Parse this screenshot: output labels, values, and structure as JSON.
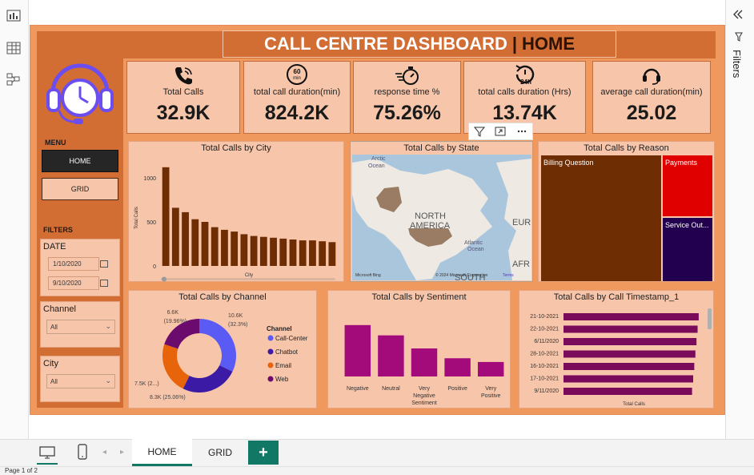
{
  "title": {
    "main": "CALL CENTRE DASHBOARD",
    "separator": "|",
    "page": "HOME"
  },
  "kpis": [
    {
      "icon": "phone-icon",
      "label": "Total Calls",
      "value": "32.9K"
    },
    {
      "icon": "sixty-min-icon",
      "icon_text": "60 min",
      "label": "total call duration(min)",
      "value": "824.2K"
    },
    {
      "icon": "stopwatch-icon",
      "label": "response time %",
      "value": "75.26%"
    },
    {
      "icon": "clock-24h-icon",
      "icon_text": "24h",
      "label": "total calls duration (Hrs)",
      "value": "13.74K"
    },
    {
      "icon": "headset-icon",
      "label": "average call duration(min)",
      "value": "25.02"
    }
  ],
  "sidebar": {
    "menu_label": "MENU",
    "menu_items": [
      {
        "label": "HOME",
        "active": true
      },
      {
        "label": "GRID",
        "active": false
      }
    ],
    "filters_label": "FILTERS",
    "date_label": "DATE",
    "date_from": "1/10/2020",
    "date_to": "9/10/2020",
    "channel_label": "Channel",
    "channel_value": "All",
    "city_label": "City",
    "city_value": "All"
  },
  "visual_header_icons": [
    "filter-icon",
    "focus-mode-icon",
    "more-options-icon"
  ],
  "map": {
    "labels": {
      "arctic": "Arctic Ocean",
      "north_america": "NORTH AMERICA",
      "atlantic": "Atlantic Ocean",
      "europe": "EUR",
      "africa": "AFR",
      "south": "SOUTH",
      "logo": "Microsoft Bing",
      "copyright": "© 2024 Microsoft Corporation",
      "terms": "Terms"
    }
  },
  "treemap": {
    "items": [
      {
        "label": "Billing Question",
        "color": "#6e2d02"
      },
      {
        "label": "Payments",
        "color": "#e00000"
      },
      {
        "label": "Service Out...",
        "color": "#22004f"
      }
    ]
  },
  "tabs": {
    "home": "HOME",
    "grid": "GRID",
    "add": "+"
  },
  "status": "Page 1 of 2",
  "filters_pane": "Filters",
  "colors": {
    "sidebar": "#d26d34",
    "background": "#f0995f",
    "card": "#f7c5aa",
    "bar_brown": "#6e2d02",
    "bar_magenta": "#a30b7a",
    "bar_plum": "#7a0a5a"
  },
  "chart_data": [
    {
      "type": "bar",
      "title": "Total Calls by City",
      "xlabel": "City",
      "ylabel": "Total Calls",
      "ylim": [
        0,
        1000
      ],
      "yticks": [
        "0",
        "500",
        "1000"
      ],
      "values": [
        1120,
        660,
        610,
        530,
        500,
        440,
        410,
        390,
        360,
        340,
        330,
        320,
        310,
        300,
        290,
        290,
        280,
        270
      ]
    },
    {
      "type": "pie",
      "title": "Total Calls by Channel",
      "legend_title": "Channel",
      "slices": [
        {
          "name": "Call-Center",
          "value": 10.6,
          "label_value": "10.6K",
          "label_pct": "(32.3%)",
          "color": "#5a5bf5"
        },
        {
          "name": "Chatbot",
          "value": 8.3,
          "label_value": "8.3K (25.06%)",
          "color": "#3b1aa6"
        },
        {
          "name": "Email",
          "value": 7.5,
          "label_value": "7.5K (2...)",
          "color": "#e7640b"
        },
        {
          "name": "Web",
          "value": 6.6,
          "label_value": "6.6K",
          "label_pct": "(19.96%)",
          "color": "#6c0b6e"
        }
      ]
    },
    {
      "type": "bar",
      "title": "Total Calls by Sentiment",
      "categories": [
        "Negative",
        "Neutral",
        "Very Negative Sentiment",
        "Positive",
        "Very Positive"
      ],
      "category_lines": [
        [
          "Negative"
        ],
        [
          "Neutral"
        ],
        [
          "Very",
          "Negative",
          "Sentiment"
        ],
        [
          "Positive"
        ],
        [
          "Very",
          "Positive"
        ]
      ],
      "values": [
        11000,
        8800,
        6000,
        3900,
        3100
      ],
      "ylim": [
        0,
        12000
      ]
    },
    {
      "type": "bar",
      "orientation": "horizontal",
      "title": "Total Calls by Call Timestamp_1",
      "xlabel": "Total Calls",
      "categories": [
        "21-10-2021",
        "22-10-2021",
        "6/11/2020",
        "28-10-2021",
        "16-10-2021",
        "17-10-2021",
        "9/11/2020"
      ],
      "values": [
        1220,
        1210,
        1200,
        1190,
        1180,
        1170,
        1160
      ],
      "xlim": [
        0,
        1300
      ]
    }
  ]
}
